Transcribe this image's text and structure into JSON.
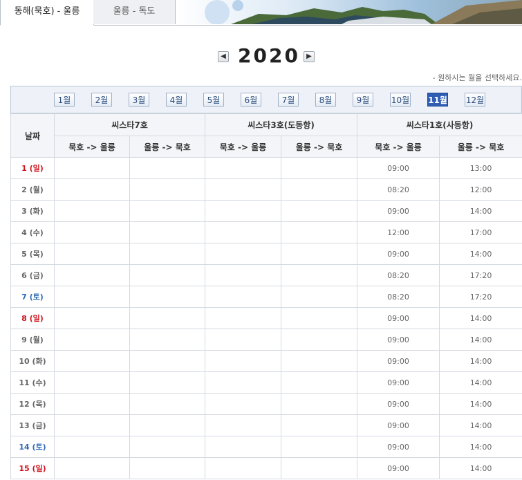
{
  "tabs": [
    {
      "label": "동해(묵호) - 울릉",
      "active": true
    },
    {
      "label": "울릉 - 독도",
      "active": false
    }
  ],
  "year_nav": {
    "year": "2020",
    "prev_icon": "chevron-left-icon",
    "next_icon": "chevron-right-icon"
  },
  "hint": "- 원하시는 월을 선택하세요.",
  "months": [
    "1월",
    "2월",
    "3월",
    "4월",
    "5월",
    "6월",
    "7월",
    "8월",
    "9월",
    "10월",
    "11월",
    "12월"
  ],
  "selected_month": "11월",
  "table": {
    "date_header": "날짜",
    "ships": [
      "씨스타7호",
      "씨스타3호(도동항)",
      "씨스타1호(사동항)"
    ],
    "directions": [
      "묵호 -> 울릉",
      "울릉 -> 묵호"
    ],
    "rows": [
      {
        "date": "1 (일)",
        "day": "sun",
        "s1": "09:00",
        "s2": "13:00"
      },
      {
        "date": "2 (월)",
        "day": "",
        "s1": "08:20",
        "s2": "12:00"
      },
      {
        "date": "3 (화)",
        "day": "",
        "s1": "09:00",
        "s2": "14:00"
      },
      {
        "date": "4 (수)",
        "day": "",
        "s1": "12:00",
        "s2": "17:00"
      },
      {
        "date": "5 (목)",
        "day": "",
        "s1": "09:00",
        "s2": "14:00"
      },
      {
        "date": "6 (금)",
        "day": "",
        "s1": "08:20",
        "s2": "17:20"
      },
      {
        "date": "7 (토)",
        "day": "sat",
        "s1": "08:20",
        "s2": "17:20"
      },
      {
        "date": "8 (일)",
        "day": "sun",
        "s1": "09:00",
        "s2": "14:00"
      },
      {
        "date": "9 (월)",
        "day": "",
        "s1": "09:00",
        "s2": "14:00"
      },
      {
        "date": "10 (화)",
        "day": "",
        "s1": "09:00",
        "s2": "14:00"
      },
      {
        "date": "11 (수)",
        "day": "",
        "s1": "09:00",
        "s2": "14:00"
      },
      {
        "date": "12 (목)",
        "day": "",
        "s1": "09:00",
        "s2": "14:00"
      },
      {
        "date": "13 (금)",
        "day": "",
        "s1": "09:00",
        "s2": "14:00"
      },
      {
        "date": "14 (토)",
        "day": "sat",
        "s1": "09:00",
        "s2": "14:00"
      },
      {
        "date": "15 (일)",
        "day": "sun",
        "s1": "09:00",
        "s2": "14:00"
      }
    ]
  },
  "colors": {
    "sunday": "#d0121b",
    "saturday": "#2f6ab5",
    "active_month": "#2f5db4"
  }
}
